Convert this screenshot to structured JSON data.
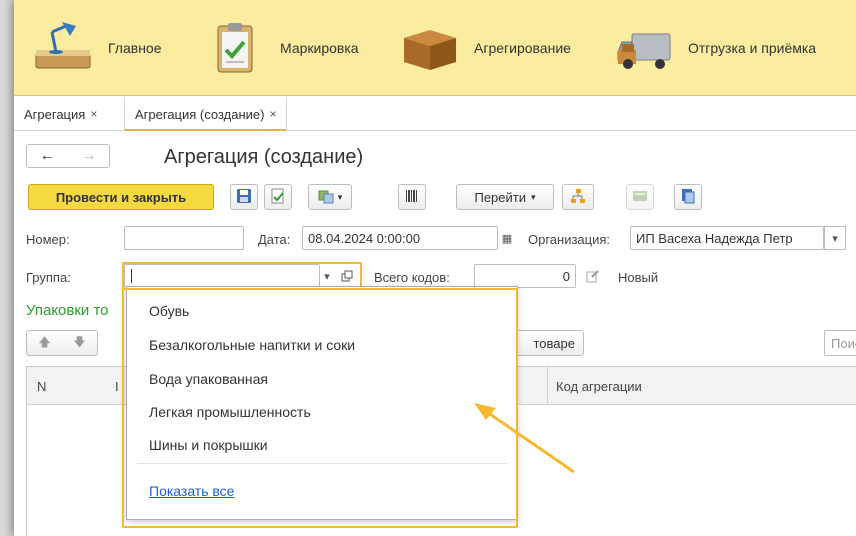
{
  "sections": [
    {
      "label": "Главное"
    },
    {
      "label": "Маркировка"
    },
    {
      "label": "Агрегирование"
    },
    {
      "label": "Отгрузка и приёмка"
    }
  ],
  "tabs": [
    {
      "label": "Агрегация",
      "close": "×"
    },
    {
      "label": "Агрегация (создание)",
      "close": "×"
    }
  ],
  "header": {
    "title": "Агрегация (создание)",
    "back": "←",
    "forward": "→"
  },
  "toolbar": {
    "post_close": "Провести и закрыть",
    "go_to": "Перейти"
  },
  "form": {
    "number_label": "Номер:",
    "number_value": "",
    "date_label": "Дата:",
    "date_value": "08.04.2024  0:00:00",
    "org_label": "Организация:",
    "org_value": "ИП Васеха Надежда Петр",
    "group_label": "Группа:",
    "group_value": "",
    "total_codes_label": "Всего кодов:",
    "total_codes_value": "0",
    "status": "Новый"
  },
  "packages": {
    "caption": "Упаковки то",
    "goods_button": "товаре",
    "search_placeholder": "Поис"
  },
  "table": {
    "columns": [
      "N",
      "I",
      "Код агрегации"
    ]
  },
  "dropdown": {
    "items": [
      "Обувь",
      "Безалкогольные напитки и соки",
      "Вода упакованная",
      "Легкая промышленность",
      "Шины и покрышки"
    ],
    "show_all": "Показать все"
  },
  "colors": {
    "section_bar": "#fbeca0",
    "primary_button": "#f5d93e",
    "highlight": "#f5b82e",
    "caption_green": "#2f9a2f",
    "link": "#1d62c4"
  },
  "icons": [
    "desk-lamp-icon",
    "clipboard-icon",
    "box-icon",
    "delivery-truck-icon"
  ]
}
